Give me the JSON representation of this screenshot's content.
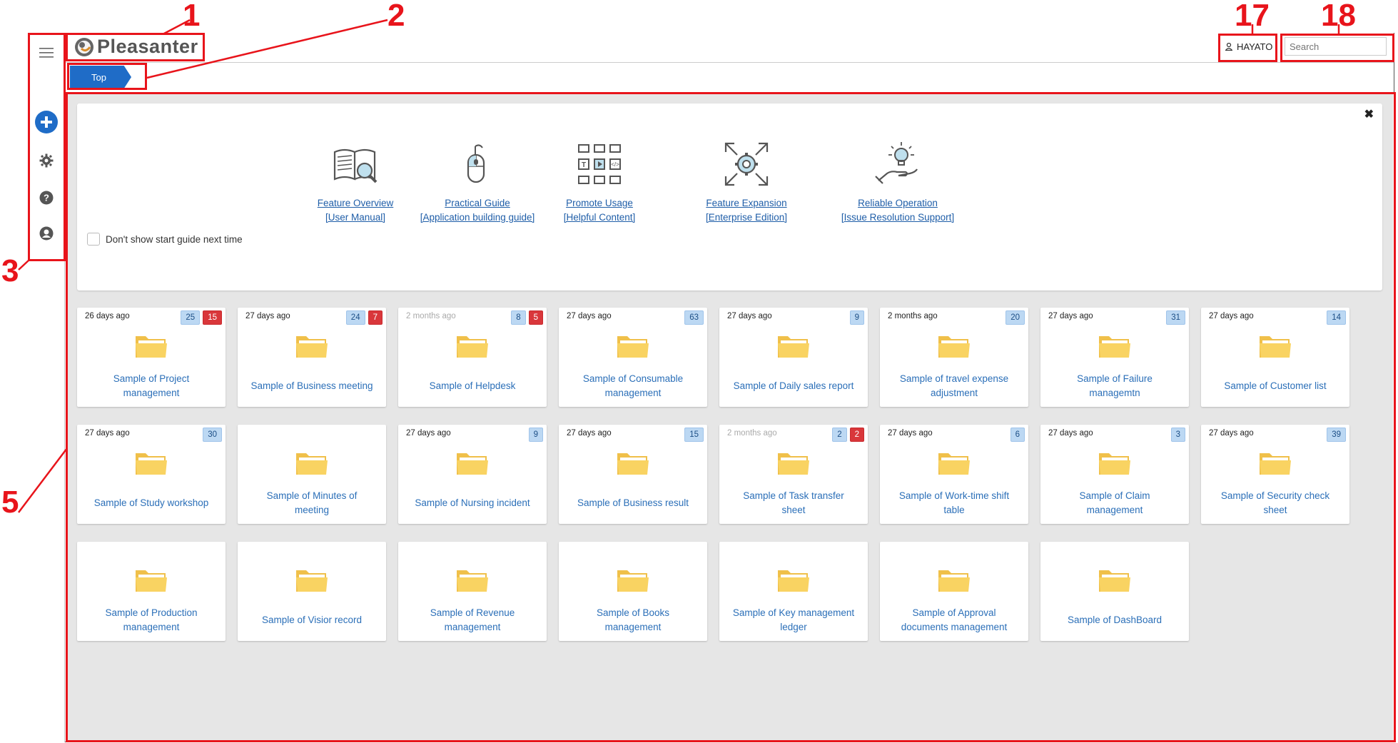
{
  "app": {
    "logo_text": "Pleasanter",
    "user_name": "HAYATO",
    "search_placeholder": "Search"
  },
  "breadcrumb": {
    "top_label": "Top"
  },
  "start_guide": {
    "items": [
      {
        "line1": "Feature Overview",
        "line2": "[User Manual]",
        "icon": "book-magnifier-icon"
      },
      {
        "line1": "Practical Guide",
        "line2": "[Application building guide]",
        "icon": "mouse-click-icon"
      },
      {
        "line1": "Promote Usage",
        "line2": "[Helpful Content]",
        "icon": "content-grid-icon"
      },
      {
        "line1": "Feature Expansion",
        "line2": "[Enterprise Edition]",
        "icon": "expand-gear-icon"
      },
      {
        "line1": "Reliable Operation",
        "line2": "[Issue Resolution Support]",
        "icon": "lightbulb-hand-icon"
      }
    ],
    "dont_show_label": "Don't show start guide next time",
    "close_glyph": "✖"
  },
  "sites": [
    {
      "time": "26 days ago",
      "time_grey": false,
      "badges": [
        {
          "v": "25",
          "c": "blue"
        },
        {
          "v": "15",
          "c": "red"
        }
      ],
      "name1": "Sample of Project",
      "name2": "management"
    },
    {
      "time": "27 days ago",
      "time_grey": false,
      "badges": [
        {
          "v": "24",
          "c": "blue"
        },
        {
          "v": "7",
          "c": "red"
        }
      ],
      "name1": "Sample of Business meeting",
      "name2": ""
    },
    {
      "time": "2 months ago",
      "time_grey": true,
      "badges": [
        {
          "v": "8",
          "c": "blue"
        },
        {
          "v": "5",
          "c": "red"
        }
      ],
      "name1": "Sample of Helpdesk",
      "name2": ""
    },
    {
      "time": "27 days ago",
      "time_grey": false,
      "badges": [
        {
          "v": "63",
          "c": "blue"
        }
      ],
      "name1": "Sample of Consumable",
      "name2": "management"
    },
    {
      "time": "27 days ago",
      "time_grey": false,
      "badges": [
        {
          "v": "9",
          "c": "blue"
        }
      ],
      "name1": "Sample of Daily sales report",
      "name2": ""
    },
    {
      "time": "2 months ago",
      "time_grey": false,
      "badges": [
        {
          "v": "20",
          "c": "blue"
        }
      ],
      "name1": "Sample of travel expense",
      "name2": "adjustment"
    },
    {
      "time": "27 days ago",
      "time_grey": false,
      "badges": [
        {
          "v": "31",
          "c": "blue"
        }
      ],
      "name1": "Sample of Failure",
      "name2": "managemtn"
    },
    {
      "time": "27 days ago",
      "time_grey": false,
      "badges": [
        {
          "v": "14",
          "c": "blue"
        }
      ],
      "name1": "Sample of Customer list",
      "name2": ""
    },
    {
      "time": "27 days ago",
      "time_grey": false,
      "badges": [
        {
          "v": "30",
          "c": "blue"
        }
      ],
      "name1": "Sample of Study workshop",
      "name2": ""
    },
    {
      "time": "",
      "time_grey": false,
      "badges": [],
      "name1": "Sample of Minutes of",
      "name2": "meeting"
    },
    {
      "time": "27 days ago",
      "time_grey": false,
      "badges": [
        {
          "v": "9",
          "c": "blue"
        }
      ],
      "name1": "Sample of Nursing incident",
      "name2": ""
    },
    {
      "time": "27 days ago",
      "time_grey": false,
      "badges": [
        {
          "v": "15",
          "c": "blue"
        }
      ],
      "name1": "Sample of Business result",
      "name2": ""
    },
    {
      "time": "2 months ago",
      "time_grey": true,
      "badges": [
        {
          "v": "2",
          "c": "blue"
        },
        {
          "v": "2",
          "c": "red"
        }
      ],
      "name1": "Sample of Task transfer",
      "name2": "sheet"
    },
    {
      "time": "27 days ago",
      "time_grey": false,
      "badges": [
        {
          "v": "6",
          "c": "blue"
        }
      ],
      "name1": "Sample of Work-time shift",
      "name2": "table"
    },
    {
      "time": "27 days ago",
      "time_grey": false,
      "badges": [
        {
          "v": "3",
          "c": "blue"
        }
      ],
      "name1": "Sample of Claim",
      "name2": "management"
    },
    {
      "time": "27 days ago",
      "time_grey": false,
      "badges": [
        {
          "v": "39",
          "c": "blue"
        }
      ],
      "name1": "Sample of Security check",
      "name2": "sheet"
    },
    {
      "time": "",
      "time_grey": false,
      "badges": [],
      "name1": "Sample of Production",
      "name2": "management"
    },
    {
      "time": "",
      "time_grey": false,
      "badges": [],
      "name1": "Sample of Visior record",
      "name2": ""
    },
    {
      "time": "",
      "time_grey": false,
      "badges": [],
      "name1": "Sample of Revenue",
      "name2": "management"
    },
    {
      "time": "",
      "time_grey": false,
      "badges": [],
      "name1": "Sample of Books",
      "name2": "management"
    },
    {
      "time": "",
      "time_grey": false,
      "badges": [],
      "name1": "Sample of Key management",
      "name2": "ledger"
    },
    {
      "time": "",
      "time_grey": false,
      "badges": [],
      "name1": "Sample of Approval",
      "name2": "documents management"
    },
    {
      "time": "",
      "time_grey": false,
      "badges": [],
      "name1": "Sample of DashBoard",
      "name2": ""
    }
  ],
  "annotations": [
    "1",
    "2",
    "3",
    "5",
    "17",
    "18"
  ],
  "colors": {
    "accent": "#1f6cc7",
    "annotation": "#e8141b",
    "folder": "#f9d362",
    "badge_red": "#d9373b",
    "badge_blue": "#bcd8f3"
  }
}
